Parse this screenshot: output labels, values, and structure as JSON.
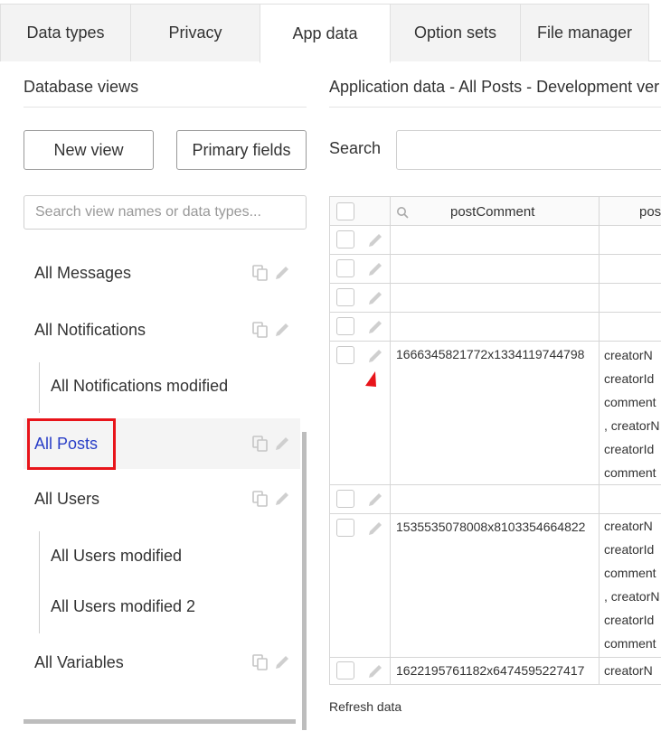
{
  "tabs": [
    {
      "label": "Data types"
    },
    {
      "label": "Privacy"
    },
    {
      "label": "App data",
      "active": true
    },
    {
      "label": "Option sets"
    },
    {
      "label": "File manager"
    }
  ],
  "left_panel": {
    "title": "Database views",
    "new_view_label": "New view",
    "primary_fields_label": "Primary fields",
    "search_placeholder": "Search view names or data types...",
    "views": [
      {
        "label": "All Messages"
      },
      {
        "label": "All Notifications"
      },
      {
        "label": "All Notifications modified"
      },
      {
        "label": "All Posts",
        "selected": true
      },
      {
        "label": "All Users"
      },
      {
        "label": "All Users modified"
      },
      {
        "label": "All Users modified 2"
      },
      {
        "label": "All Variables"
      }
    ]
  },
  "right_panel": {
    "title": "Application data - All Posts - Development ver",
    "search_label": "Search",
    "columns": [
      "postComment",
      "pos"
    ],
    "rows": [
      {
        "postComment": "",
        "col2": []
      },
      {
        "postComment": "",
        "col2": []
      },
      {
        "postComment": "",
        "col2": []
      },
      {
        "postComment": "",
        "col2": []
      },
      {
        "postComment": "1666345821772x13341197447​98",
        "col2": [
          "creatorN",
          "creatorId",
          "comment",
          ", creatorN",
          "creatorId",
          "comment"
        ]
      },
      {
        "postComment": "",
        "col2": []
      },
      {
        "postComment": "1535535078008x81033546648​22",
        "col2": [
          "creatorN",
          "creatorId",
          "comment",
          ", creatorN",
          "creatorId",
          "comment"
        ]
      },
      {
        "postComment": "1622195761182x64745952274​17",
        "col2": [
          "creatorN"
        ]
      }
    ],
    "refresh_label": "Refresh data"
  },
  "colors": {
    "accent": "#2a3fc7",
    "highlight": "#e8141a",
    "tab_bg": "#f3f3f3"
  },
  "icons": [
    "search-icon",
    "pencil-icon",
    "copy-icon",
    "red-cursor-marker"
  ]
}
